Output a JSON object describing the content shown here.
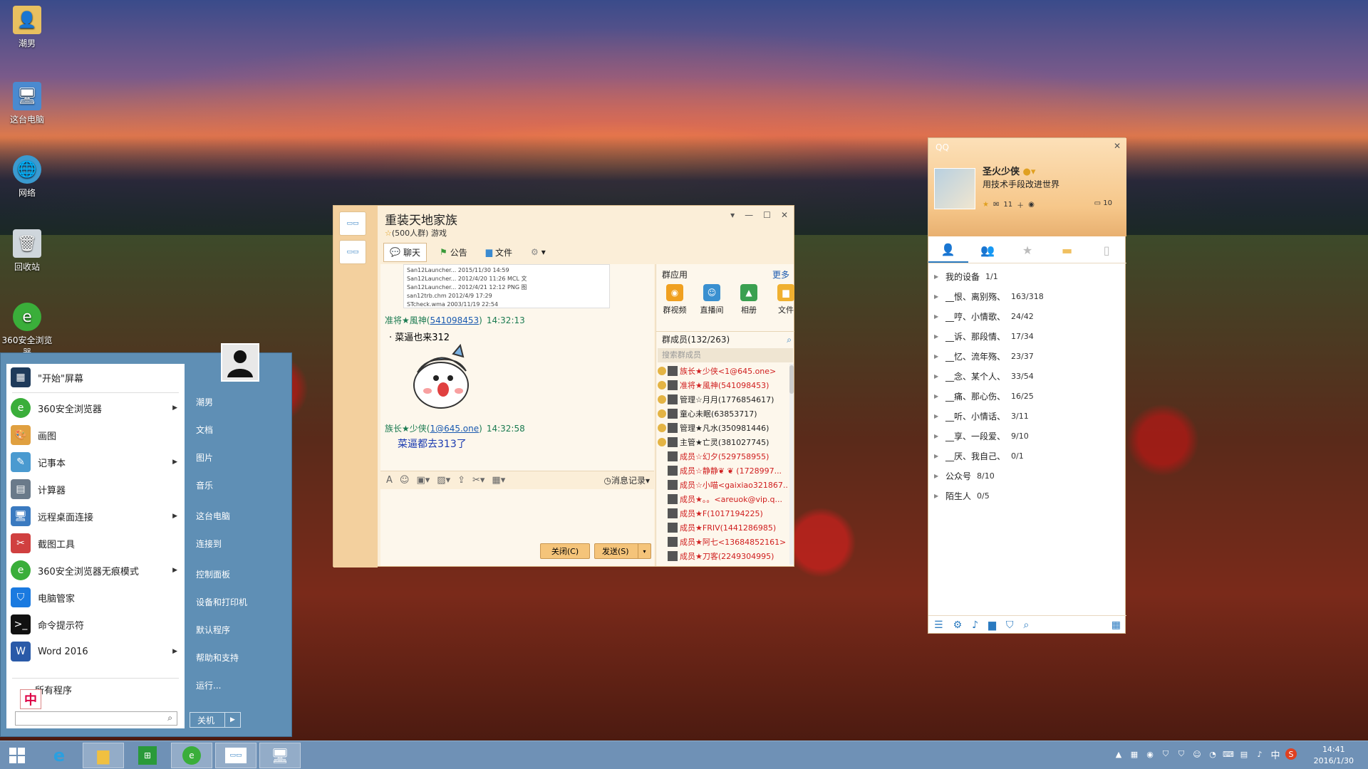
{
  "desktop": {
    "icons": [
      {
        "label": "潮男",
        "icon": "folder-user-icon"
      },
      {
        "label": "这台电脑",
        "icon": "computer-icon"
      },
      {
        "label": "网络",
        "icon": "network-icon"
      },
      {
        "label": "回收站",
        "icon": "recycle-bin-icon"
      },
      {
        "label": "360安全浏览器",
        "icon": "browser-360-icon"
      }
    ]
  },
  "start_menu": {
    "items": [
      {
        "label": "\"开始\"屏幕",
        "arrow": false
      },
      {
        "label": "360安全浏览器",
        "arrow": true
      },
      {
        "label": "画图",
        "arrow": false
      },
      {
        "label": "记事本",
        "arrow": true
      },
      {
        "label": "计算器",
        "arrow": false
      },
      {
        "label": "远程桌面连接",
        "arrow": true
      },
      {
        "label": "截图工具",
        "arrow": false
      },
      {
        "label": "360安全浏览器无痕模式",
        "arrow": true
      },
      {
        "label": "电脑管家",
        "arrow": false
      },
      {
        "label": "命令提示符",
        "arrow": false
      },
      {
        "label": "Word 2016",
        "arrow": true
      }
    ],
    "all_programs": "所有程序",
    "right_items": [
      "潮男",
      "文档",
      "图片",
      "音乐",
      "这台电脑",
      "连接到",
      "控制面板",
      "设备和打印机",
      "默认程序",
      "帮助和支持",
      "运行..."
    ],
    "shutdown": "关机",
    "ime": "中"
  },
  "chat": {
    "title": "重装天地家族",
    "subtitle": "(500人群) 游戏",
    "toolbar": {
      "chat": "聊天",
      "notice": "公告",
      "file": "文件"
    },
    "files": [
      "San12Launcher... 2015/11/30 14:59",
      "San12Launcher... 2012/4/20 11:26  MCL 文",
      "San12Launcher... 2012/4/21 12:12  PNG 图",
      "san12trb.chm  2012/4/9 17:29",
      "STcheck.wma  2003/11/19 22:54"
    ],
    "messages": [
      {
        "sender": "准将★風神(",
        "qq": "541098453",
        "close": ")",
        "time": "14:32:13",
        "text": "菜逼也来312"
      },
      {
        "sender": "族长★少侠(",
        "qq": "1@645.one",
        "close": ")",
        "time": "14:32:58",
        "text": "菜逼都去313了"
      }
    ],
    "history": "消息记录",
    "close_btn": "关闭(C)",
    "send_btn": "发送(S)",
    "apps_title": "群应用",
    "apps_more": "更多",
    "apps": [
      {
        "label": "群视频",
        "color": "#f0a020"
      },
      {
        "label": "直播间",
        "color": "#3a90d0"
      },
      {
        "label": "相册",
        "color": "#3aa050"
      },
      {
        "label": "文件",
        "color": "#f0b030"
      }
    ],
    "members_title": "群成员(132/263)",
    "members_search": "搜索群成员",
    "members": [
      {
        "name": "族长★少侠<1@645.one>",
        "red": true
      },
      {
        "name": "准将★風神(541098453)",
        "red": true
      },
      {
        "name": "管理☆月月(1776854617)",
        "red": false
      },
      {
        "name": "童心未眠(63853717)",
        "red": false
      },
      {
        "name": "管理★凡水(350981446)",
        "red": false
      },
      {
        "name": "主管★亡灵(381027745)",
        "red": false
      },
      {
        "name": "成员☆幻夕(529758955)",
        "red": true
      },
      {
        "name": "成员☆静静❦ ❦ (1728997...",
        "red": true
      },
      {
        "name": "成员☆小喵<gaixiao321867...",
        "red": true
      },
      {
        "name": "成员★。。<areuok@vip.q...",
        "red": true
      },
      {
        "name": "成员★F(1017194225)",
        "red": true
      },
      {
        "name": "成员★FRIV(1441286985)",
        "red": true
      },
      {
        "name": "成员★阿七<13684852161>",
        "red": true
      },
      {
        "name": "成员★刀客(2249304995)",
        "red": true
      }
    ]
  },
  "qq": {
    "logo": "QQ",
    "name": "圣火少侠",
    "signature": "用技术手段改进世界",
    "stats": [
      "11",
      "10"
    ],
    "groups": [
      {
        "name": "我的设备",
        "count": "1/1"
      },
      {
        "name": "__恨、离别殇、",
        "count": "163/318"
      },
      {
        "name": "__哼、小情歌、",
        "count": "24/42"
      },
      {
        "name": "__诉、那段情、",
        "count": "17/34"
      },
      {
        "name": "__忆、流年殇、",
        "count": "23/37"
      },
      {
        "name": "__念、某个人、",
        "count": "33/54"
      },
      {
        "name": "__痛、那心伤、",
        "count": "16/25"
      },
      {
        "name": "__听、小情话、",
        "count": "3/11"
      },
      {
        "name": "__享、一段爱、",
        "count": "9/10"
      },
      {
        "name": "__厌、我自己、",
        "count": "0/1"
      },
      {
        "name": "公众号",
        "count": "8/10"
      },
      {
        "name": "陌生人",
        "count": "0/5"
      }
    ]
  },
  "taskbar": {
    "time": "14:41",
    "date": "2016/1/30"
  }
}
